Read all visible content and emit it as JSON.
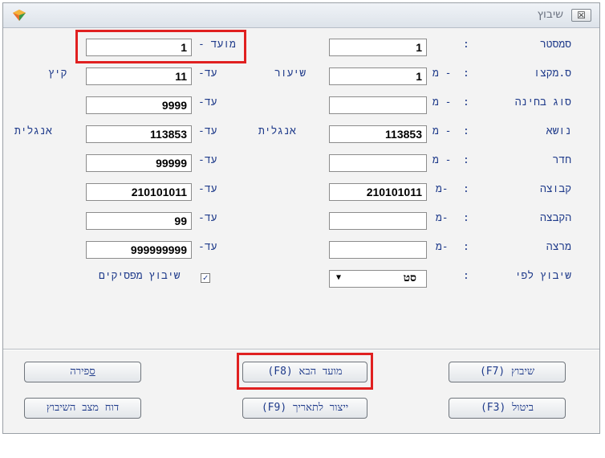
{
  "window": {
    "title": "שיבוץ",
    "close_label": "☒"
  },
  "right_labels": {
    "semester": "סמסטר",
    "course": "ס.מקצו",
    "exam_type": "סוג בחינה",
    "subject": "נושא",
    "room": "חדר",
    "group": "קבוצה",
    "allocation": "הקבצה",
    "lecturer": "מרצה",
    "assign_by": "שיבוץ לפי"
  },
  "colons": [
    ":",
    ":",
    ":",
    ":",
    ":",
    ":",
    ":",
    ":",
    ":"
  ],
  "from_marks": [
    "- מ",
    "- מ",
    "- מ",
    "- מ",
    "-מ",
    "-מ",
    "-מ"
  ],
  "to_marks": [
    "עד-",
    "עד-",
    "עד-",
    "עד-",
    "עד-",
    "עד-",
    "עד-"
  ],
  "from_fields": {
    "semester": "1",
    "course": "1",
    "exam_type": "",
    "subject": "113853",
    "room": "",
    "group": "210101011",
    "allocation": "",
    "lecturer": ""
  },
  "mid_labels": {
    "course": "שיעור",
    "subject": "אנגלית"
  },
  "to_fields": {
    "session": "1",
    "course": "11",
    "exam_type": "9999",
    "subject": "113853",
    "room": "99999",
    "group": "210101011",
    "allocation": "99",
    "lecturer": "999999999"
  },
  "session_label": "מועד -",
  "left_labels": {
    "course": "קיץ",
    "subject": "אנגלית"
  },
  "assign_by_value": "סט",
  "assign_by_arrow": "▼",
  "breaks_checkbox": {
    "label": "שיבוץ מפסיקים",
    "checked_glyph": "✓"
  },
  "buttons": {
    "assign": "שיבוץ (F7)",
    "next_session": "מועד הבא (F8)",
    "count_pre": "",
    "count_underline": "ס",
    "count_post": "פירה",
    "cancel": "ביטול (F3)",
    "create_date": "ייצור לתאריך (F9)",
    "report": "דוח מצב השיבוץ"
  }
}
